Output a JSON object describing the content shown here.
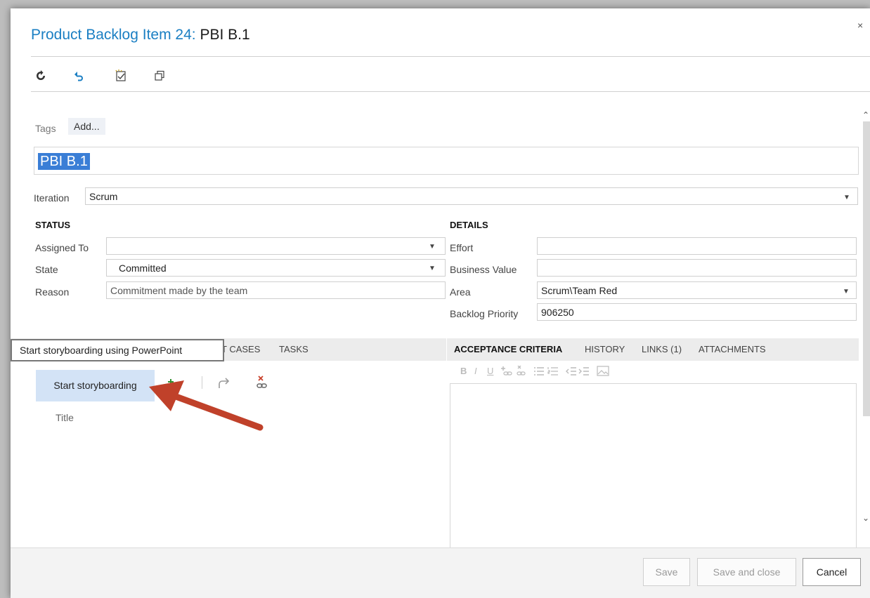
{
  "dialog": {
    "title_prefix": "Product Backlog Item 24: ",
    "title_name": "PBI B.1",
    "close_glyph": "×"
  },
  "toolbar": {
    "icons": [
      "refresh-icon",
      "undo-icon",
      "template-icon",
      "copy-icon"
    ]
  },
  "tags": {
    "label": "Tags",
    "add": "Add..."
  },
  "work_item_title": "PBI B.1",
  "iteration": {
    "label": "Iteration",
    "value": "Scrum"
  },
  "status": {
    "heading": "STATUS",
    "assigned_to": {
      "label": "Assigned To",
      "value": ""
    },
    "state": {
      "label": "State",
      "value": "Committed"
    },
    "reason": {
      "label": "Reason",
      "value": "Commitment made by the team"
    }
  },
  "details": {
    "heading": "DETAILS",
    "effort": {
      "label": "Effort",
      "value": ""
    },
    "business_value": {
      "label": "Business Value",
      "value": ""
    },
    "area": {
      "label": "Area",
      "value": "Scrum\\Team Red"
    },
    "backlog_priority": {
      "label": "Backlog Priority",
      "value": "906250"
    }
  },
  "left_tabs": {
    "test_cases": "T CASES",
    "tasks": "TASKS"
  },
  "tooltip": "Start storyboarding using PowerPoint",
  "storyboard": {
    "start_label": "Start storyboarding",
    "title_column": "Title"
  },
  "right_tabs": {
    "acceptance": "ACCEPTANCE CRITERIA",
    "history": "HISTORY",
    "links": "LINKS (1)",
    "attachments": "ATTACHMENTS"
  },
  "footer": {
    "save": "Save",
    "save_close": "Save and close",
    "cancel": "Cancel"
  },
  "colors": {
    "title_blue": "#1b7fc3",
    "selection_blue": "#3a7ed6",
    "storyboard_button": "#d3e3f6",
    "arrow_red": "#c0412a"
  }
}
